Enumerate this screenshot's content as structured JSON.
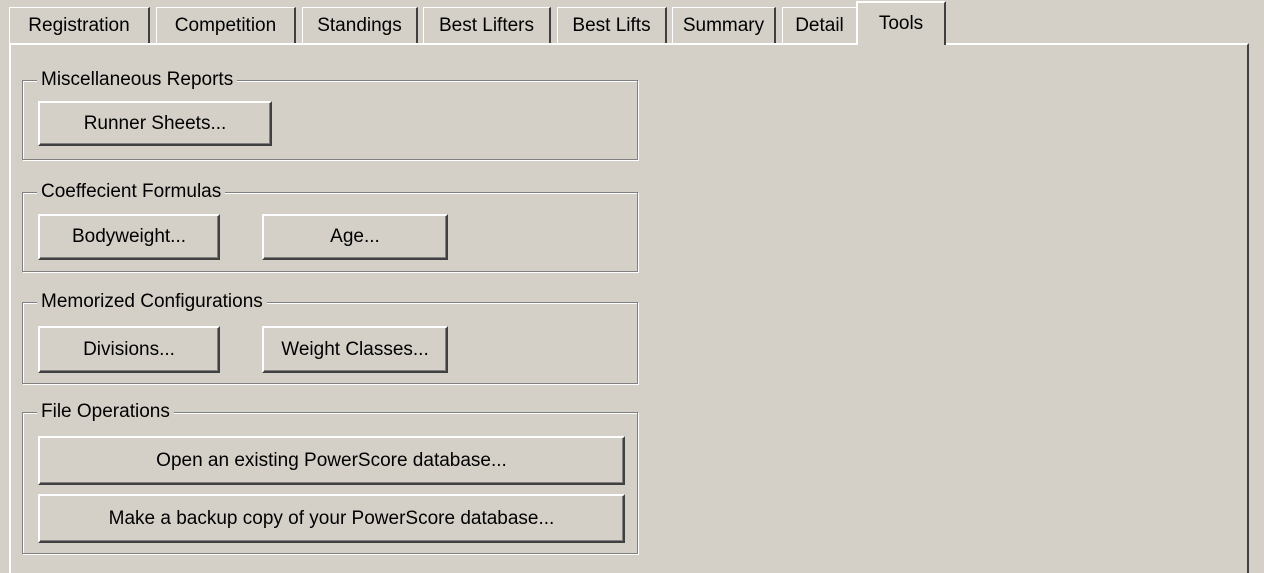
{
  "tabs": [
    {
      "label": "Registration"
    },
    {
      "label": "Competition"
    },
    {
      "label": "Standings"
    },
    {
      "label": "Best Lifters"
    },
    {
      "label": "Best Lifts"
    },
    {
      "label": "Summary"
    },
    {
      "label": "Detail"
    },
    {
      "label": "Tools",
      "active": true
    }
  ],
  "groups": {
    "misc": {
      "title": "Miscellaneous Reports",
      "runner_sheets": "Runner Sheets..."
    },
    "coeff": {
      "title": "Coeffecient Formulas",
      "bodyweight": "Bodyweight...",
      "age": "Age..."
    },
    "memorized": {
      "title": "Memorized Configurations",
      "divisions": "Divisions...",
      "weight_classes": "Weight Classes..."
    },
    "file_ops": {
      "title": "File Operations",
      "open_db": "Open an existing PowerScore database...",
      "backup_db": "Make a backup copy of your PowerScore database..."
    }
  }
}
